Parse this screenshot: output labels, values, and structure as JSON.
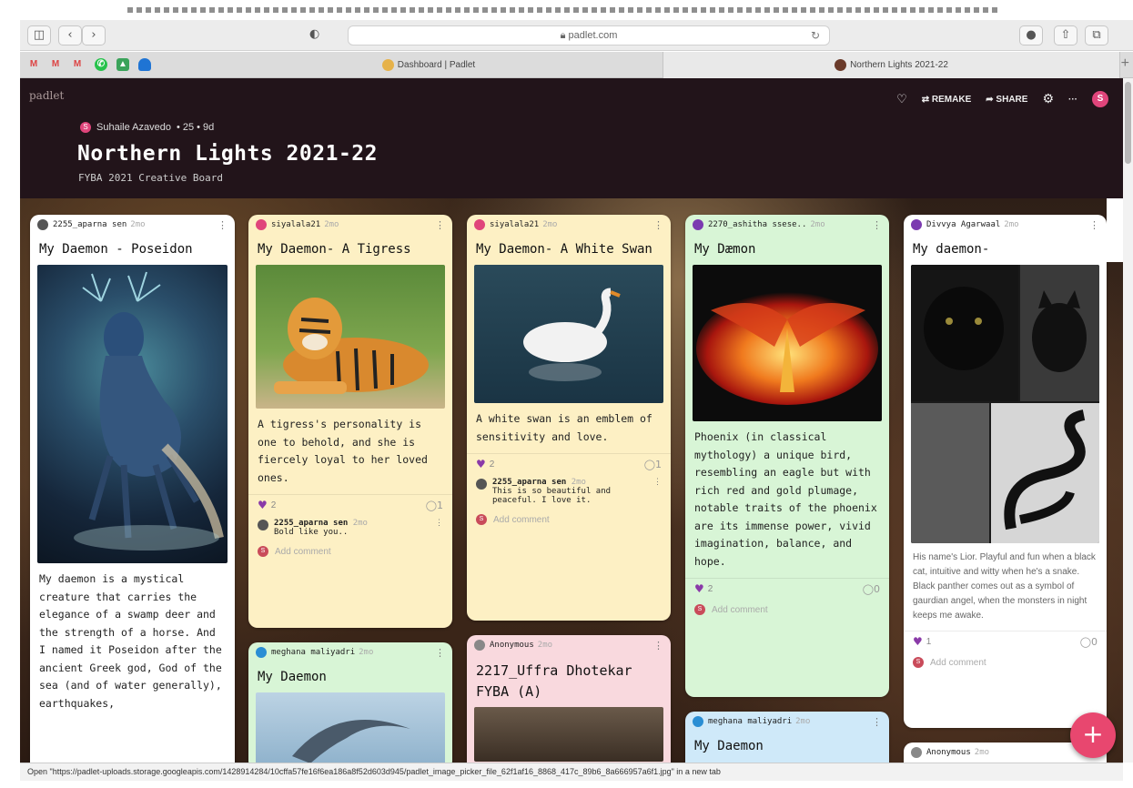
{
  "browser": {
    "url": "padlet.com",
    "tabs": [
      {
        "label": "Dashboard | Padlet"
      },
      {
        "label": "Northern Lights 2021-22"
      }
    ],
    "status_text": "Open \"https://padlet-uploads.storage.googleapis.com/1428914284/10cffa57fe16f6ea186a8f52d603d945/padlet_image_picker_file_62f1af16_8868_417c_89b6_8a666957a6f1.jpg\" in a new tab"
  },
  "header": {
    "logo": "padlet",
    "author": "Suhaile Azavedo",
    "meta": "• 25 • 9d",
    "title": "Northern Lights 2021-22",
    "subtitle": "FYBA 2021 Creative Board",
    "remake": "REMAKE",
    "share": "SHARE"
  },
  "cards": [
    {
      "author": "2255_aparna sen",
      "time": "2mo",
      "title": "My Daemon - Poseidon",
      "body": "My daemon is a mystical creature that carries the elegance of a swamp deer and the strength of a horse. And I named it Poseidon after the ancient Greek god, God of the sea (and of water generally), earthquakes,"
    },
    {
      "author": "siyalala21",
      "time": "2mo",
      "title": "My Daemon- A Tigress",
      "body": "A tigress's personality is one to behold, and she is fiercely loyal to her loved ones.",
      "likes": "2",
      "comments": "1",
      "comment": {
        "author": "2255_aparna sen",
        "time": "2mo",
        "text": "Bold like you.."
      },
      "add_comment": "Add comment"
    },
    {
      "author": "meghana maliyadri",
      "time": "2mo",
      "title": "My Daemon"
    },
    {
      "author": "siyalala21",
      "time": "2mo",
      "title": "My Daemon- A White Swan",
      "body": "A white swan is an emblem of sensitivity and love.",
      "likes": "2",
      "comments": "1",
      "comment": {
        "author": "2255_aparna sen",
        "time": "2mo",
        "text": "This is so beautiful and peaceful. I love it."
      },
      "add_comment": "Add comment"
    },
    {
      "author": "Anonymous",
      "time": "2mo",
      "title": "2217_Uffra Dhotekar FYBA (A)"
    },
    {
      "author": "2270_ashitha ssese..",
      "time": "2mo",
      "title": "My Dæmon",
      "body": "Phoenix (in classical mythology) a unique bird, resembling an eagle but with rich red and gold plumage, notable traits of the phoenix are its immense power, vivid imagination, balance, and hope.",
      "likes": "2",
      "comments": "0",
      "add_comment": "Add comment"
    },
    {
      "author": "meghana maliyadri",
      "time": "2mo",
      "title": "My Daemon"
    },
    {
      "author": "Divvya Agarwaal",
      "time": "2mo",
      "title": "My daemon-",
      "body": "His name's Lior. Playful and fun when a black cat, intuitive and witty when he's a snake. Black panther comes out as a symbol of gaurdian angel, when the monsters in night keeps me awake.",
      "likes": "1",
      "comments": "0",
      "add_comment": "Add comment"
    },
    {
      "author": "Anonymous",
      "time": "2mo"
    }
  ],
  "fab": "+",
  "colors": {
    "header_bg": "#22141a",
    "yellow_card": "#fdf0c4",
    "green_card": "#d8f5d6",
    "pink_card": "#f9d9de",
    "blue_card": "#cfe9f9",
    "white_card": "#ffffff",
    "accent": "#e8476f"
  }
}
